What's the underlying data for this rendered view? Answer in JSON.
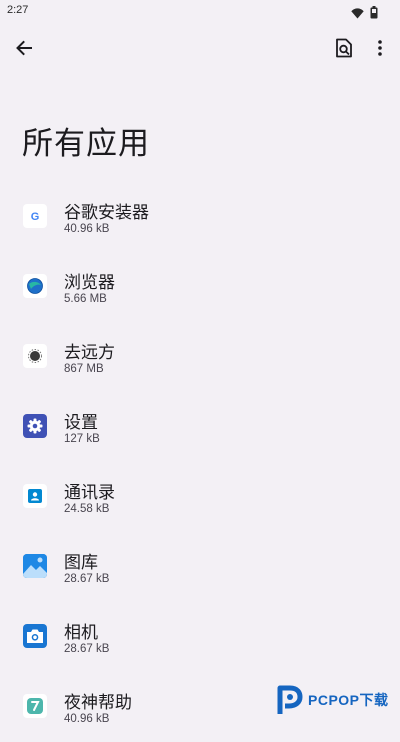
{
  "status_bar": {
    "time": "2:27",
    "icons": [
      "wifi-icon",
      "battery-icon"
    ]
  },
  "toolbar": {
    "back_icon": "arrow-back-icon",
    "search_icon": "search-in-page-icon",
    "more_icon": "more-vert-icon"
  },
  "page": {
    "title": "所有应用"
  },
  "apps": [
    {
      "name": "谷歌安装器",
      "size": "40.96 kB",
      "icon": "google-installer-icon"
    },
    {
      "name": "浏览器",
      "size": "5.66 MB",
      "icon": "browser-icon"
    },
    {
      "name": "去远方",
      "size": "867 MB",
      "icon": "quyuanfang-icon"
    },
    {
      "name": "设置",
      "size": "127 kB",
      "icon": "settings-gear-icon"
    },
    {
      "name": "通讯录",
      "size": "24.58 kB",
      "icon": "contacts-icon"
    },
    {
      "name": "图库",
      "size": "28.67 kB",
      "icon": "gallery-icon"
    },
    {
      "name": "相机",
      "size": "28.67 kB",
      "icon": "camera-icon"
    },
    {
      "name": "夜神帮助",
      "size": "40.96 kB",
      "icon": "nox-help-icon"
    }
  ],
  "watermark": {
    "text": "PCPOP下载"
  },
  "colors": {
    "background": "#f3f0f5",
    "settings_icon_bg": "#3f51b5",
    "contacts_icon_bg": "#0288d1",
    "gallery_icon_bg": "#1e88e5",
    "camera_icon_bg": "#1976d2",
    "help_icon_bg": "#26a69a",
    "watermark_blue": "#1565c0"
  }
}
